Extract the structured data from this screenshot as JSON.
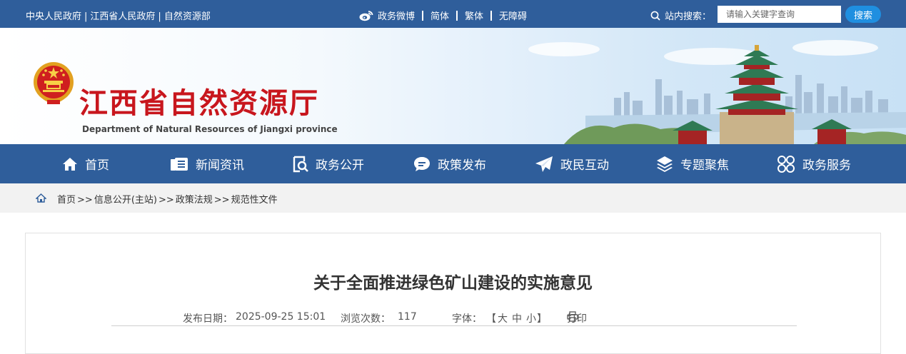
{
  "topbar": {
    "links": [
      "中央人民政府",
      "江西省人民政府",
      "自然资源部"
    ],
    "link_sep": "|",
    "weibo": "政务微博",
    "simplified": "简体",
    "traditional": "繁体",
    "accessible": "无障碍",
    "search_label": "站内搜索：",
    "search_placeholder": "请输入关键字查询",
    "search_button": "搜索"
  },
  "banner": {
    "title": "江西省自然资源厅",
    "subtitle": "Department of Natural Resources of Jiangxi province"
  },
  "nav": {
    "items": [
      {
        "label": "首页",
        "icon": "home-icon"
      },
      {
        "label": "新闻资讯",
        "icon": "news-icon"
      },
      {
        "label": "政务公开",
        "icon": "search-doc-icon"
      },
      {
        "label": "政策发布",
        "icon": "chat-icon"
      },
      {
        "label": "政民互动",
        "icon": "paper-plane-icon"
      },
      {
        "label": "专题聚焦",
        "icon": "layers-icon"
      },
      {
        "label": "政务服务",
        "icon": "grid-circles-icon"
      }
    ]
  },
  "breadcrumb": {
    "items": [
      "首页",
      "信息公开(主站)",
      "政策法规",
      "规范性文件"
    ],
    "sep": ">>"
  },
  "article": {
    "title": "关于全面推进绿色矿山建设的实施意见",
    "date_label": "发布日期：",
    "date": "2025-09-25 15:01",
    "views_label": "浏览次数：",
    "views": "117",
    "font_label": "字体：",
    "bracket_open": "【",
    "font_large": "大",
    "font_medium": "中",
    "font_small": "小",
    "bracket_close": "】",
    "print": "打印"
  },
  "colors": {
    "primary": "#2f5e9b",
    "title_red": "#c8161d",
    "search_button": "#1f8fe0",
    "breadcrumb_bg": "#f2f2f2"
  }
}
